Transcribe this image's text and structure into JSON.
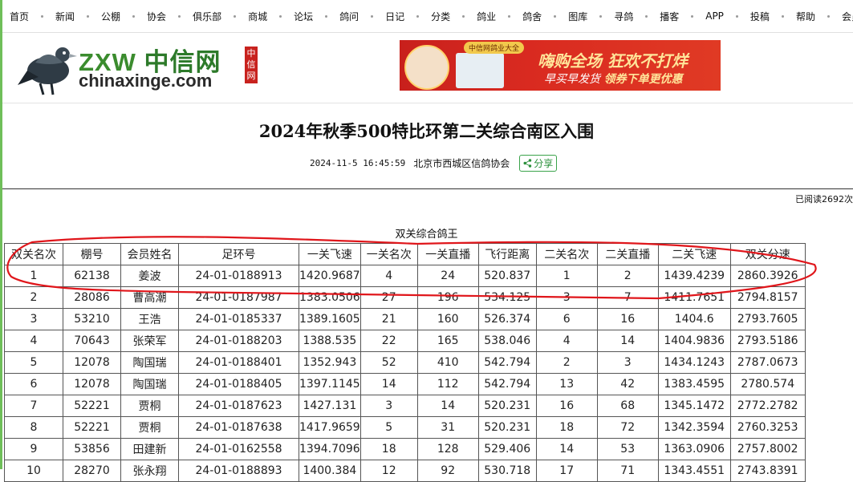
{
  "nav": {
    "items": [
      "首页",
      "新闻",
      "公棚",
      "协会",
      "俱乐部",
      "商城",
      "论坛",
      "鸽问",
      "日记",
      "分类",
      "鸽业",
      "鸽舍",
      "图库",
      "寻鸽",
      "播客",
      "APP",
      "投稿",
      "帮助",
      "会员区"
    ]
  },
  "logo": {
    "brand_latin": "ZXW",
    "brand_cn": "中信网",
    "domain": "chinaxinge.com",
    "stamp": "中信网"
  },
  "banner": {
    "pill": "中信网鸽业大全",
    "main": "嗨购全场 狂欢不打烊",
    "sub_left": "早买早发货",
    "sub_right": "领券下单更优惠"
  },
  "article": {
    "title": "2024年秋季500特比环第二关综合南区入围",
    "datetime": "2024-11-5 16:45:59",
    "organization": "北京市西城区信鸽协会",
    "share_label": "分享",
    "read_count": "已阅读2692次"
  },
  "table": {
    "caption": "双关综合鸽王",
    "columns": [
      "双关名次",
      "棚号",
      "会员姓名",
      "足环号",
      "一关飞速",
      "一关名次",
      "一关直播",
      "飞行距离",
      "二关名次",
      "二关直播",
      "二关飞速",
      "双关分速"
    ],
    "rows": [
      [
        "1",
        "62138",
        "姜波",
        "24-01-0188913",
        "1420.9687",
        "4",
        "24",
        "520.837",
        "1",
        "2",
        "1439.4239",
        "2860.3926"
      ],
      [
        "2",
        "28086",
        "曹高潮",
        "24-01-0187987",
        "1383.0506",
        "27",
        "196",
        "534.125",
        "3",
        "7",
        "1411.7651",
        "2794.8157"
      ],
      [
        "3",
        "53210",
        "王浩",
        "24-01-0185337",
        "1389.1605",
        "21",
        "160",
        "526.374",
        "6",
        "16",
        "1404.6",
        "2793.7605"
      ],
      [
        "4",
        "70643",
        "张荣军",
        "24-01-0188203",
        "1388.535",
        "22",
        "165",
        "538.046",
        "4",
        "14",
        "1404.9836",
        "2793.5186"
      ],
      [
        "5",
        "12078",
        "陶国瑞",
        "24-01-0188401",
        "1352.943",
        "52",
        "410",
        "542.794",
        "2",
        "3",
        "1434.1243",
        "2787.0673"
      ],
      [
        "6",
        "12078",
        "陶国瑞",
        "24-01-0188405",
        "1397.1145",
        "14",
        "112",
        "542.794",
        "13",
        "42",
        "1383.4595",
        "2780.574"
      ],
      [
        "7",
        "52221",
        "贾桐",
        "24-01-0187623",
        "1427.131",
        "3",
        "14",
        "520.231",
        "16",
        "68",
        "1345.1472",
        "2772.2782"
      ],
      [
        "8",
        "52221",
        "贾桐",
        "24-01-0187638",
        "1417.9659",
        "5",
        "31",
        "520.231",
        "18",
        "72",
        "1342.3594",
        "2760.3253"
      ],
      [
        "9",
        "53856",
        "田建新",
        "24-01-0162558",
        "1394.7096",
        "18",
        "128",
        "529.406",
        "14",
        "53",
        "1363.0906",
        "2757.8002"
      ],
      [
        "10",
        "28270",
        "张永翔",
        "24-01-0188893",
        "1400.384",
        "12",
        "92",
        "530.718",
        "17",
        "71",
        "1343.4551",
        "2743.8391"
      ]
    ]
  },
  "colors": {
    "brand_green": "#3b8c2e",
    "highlight_red": "#e0161b",
    "banner_red": "#d92a20"
  }
}
